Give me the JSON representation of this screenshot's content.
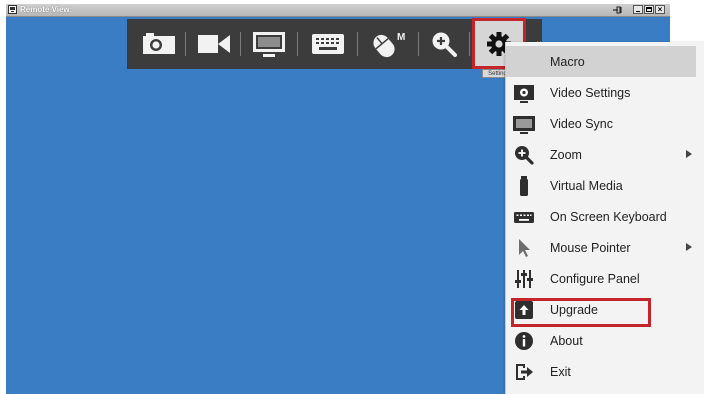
{
  "window": {
    "title": "Remote View:"
  },
  "toolbar": {
    "buttons": [
      {
        "name": "snapshot",
        "icon": "camera-icon"
      },
      {
        "name": "record",
        "icon": "video-camera-icon"
      },
      {
        "name": "video-settings",
        "icon": "monitor-icon"
      },
      {
        "name": "keyboard",
        "icon": "keyboard-icon"
      },
      {
        "name": "mouse",
        "icon": "mouse-icon"
      },
      {
        "name": "zoom",
        "icon": "zoom-in-icon"
      },
      {
        "name": "settings",
        "icon": "gear-icon"
      }
    ],
    "tooltip": "Settings"
  },
  "menu": {
    "items": [
      {
        "label": "Macro",
        "icon": "macro-icon",
        "submenu": false,
        "selected": true
      },
      {
        "label": "Video Settings",
        "icon": "video-settings-icon",
        "submenu": false
      },
      {
        "label": "Video Sync",
        "icon": "video-sync-icon",
        "submenu": false
      },
      {
        "label": "Zoom",
        "icon": "zoom-icon",
        "submenu": true
      },
      {
        "label": "Virtual Media",
        "icon": "usb-drive-icon",
        "submenu": false
      },
      {
        "label": "On Screen Keyboard",
        "icon": "keyboard-icon",
        "submenu": false
      },
      {
        "label": "Mouse Pointer",
        "icon": "mouse-pointer-icon",
        "submenu": true
      },
      {
        "label": "Configure Panel",
        "icon": "sliders-icon",
        "submenu": false
      },
      {
        "label": "Upgrade",
        "icon": "upgrade-icon",
        "submenu": false,
        "highlighted": true
      },
      {
        "label": "About",
        "icon": "info-icon",
        "submenu": false
      },
      {
        "label": "Exit",
        "icon": "exit-icon",
        "submenu": false
      }
    ]
  },
  "colors": {
    "desktop": "#3b7dc4",
    "toolbar": "#3c3c3c",
    "highlight": "#c4242b",
    "menu_bg": "#f3f3f3",
    "menu_selected": "#d2d2d2"
  }
}
